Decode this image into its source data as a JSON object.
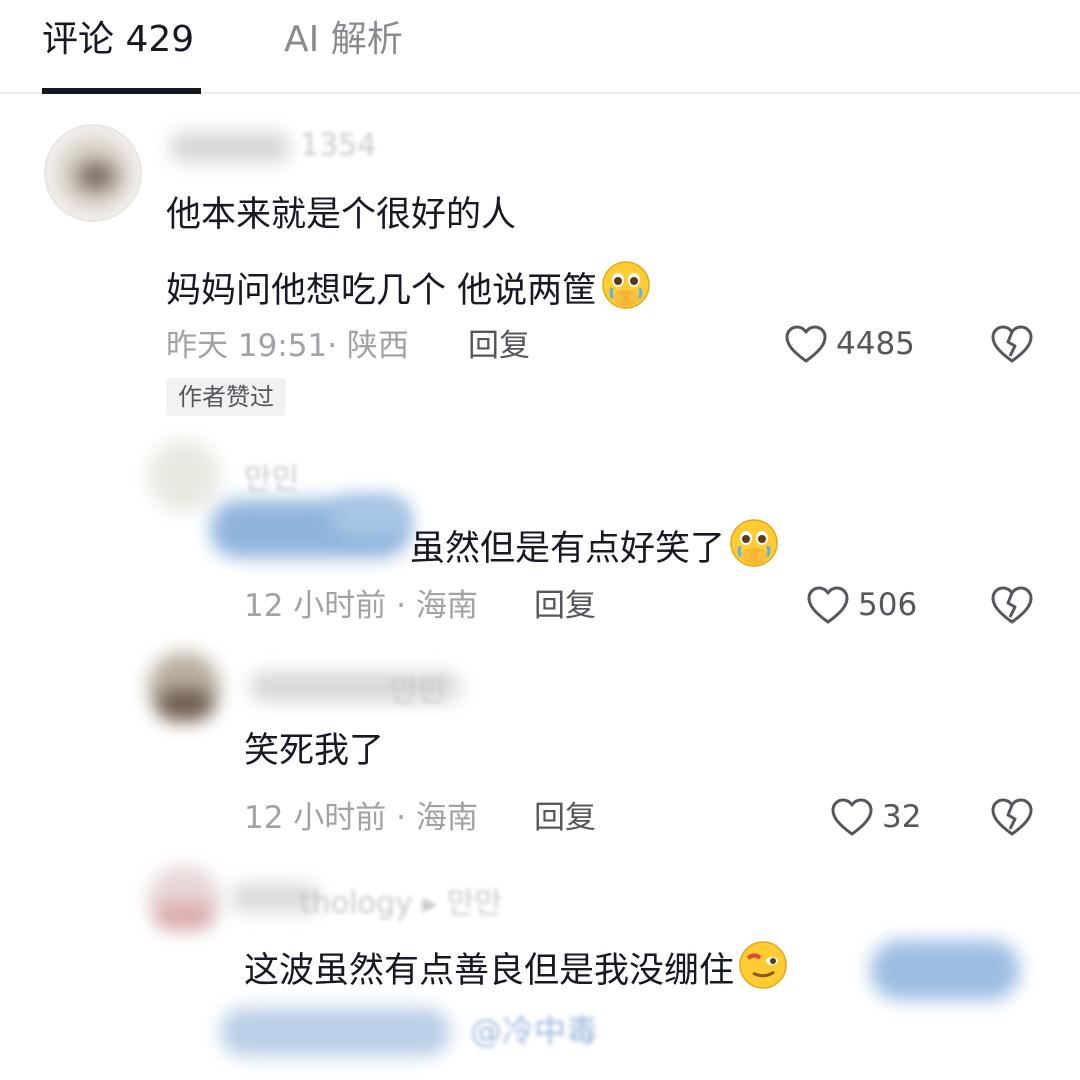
{
  "tabs": {
    "comments_label": "评论 429",
    "ai_label": "AI 解析"
  },
  "comments": [
    {
      "username": "1354",
      "lines": [
        "他本来就是个很好的人",
        "妈妈问他想吃几个 他说两筐"
      ],
      "emoji": "crying-face",
      "meta": "昨天 19:51· 陕西",
      "reply_label": "回复",
      "likes": "4485",
      "badge": "作者赞过"
    },
    {
      "username": "만민",
      "text": "虽然但是有点好笑了",
      "emoji": "crying-face",
      "meta": "12 小时前 · 海南",
      "reply_label": "回复",
      "likes": "506"
    },
    {
      "username": "만민",
      "text": "笑死我了",
      "meta": "12 小时前 · 海南",
      "reply_label": "回复",
      "likes": "32"
    },
    {
      "username": "thology ▸ 만만",
      "text": "这波虽然有点善良但是我没绷住",
      "emoji": "wink-face",
      "mention": "@冷中毒"
    }
  ],
  "colors": {
    "primary_text": "#161823",
    "secondary_text": "#a1a2a7",
    "action_text": "#56575d"
  }
}
